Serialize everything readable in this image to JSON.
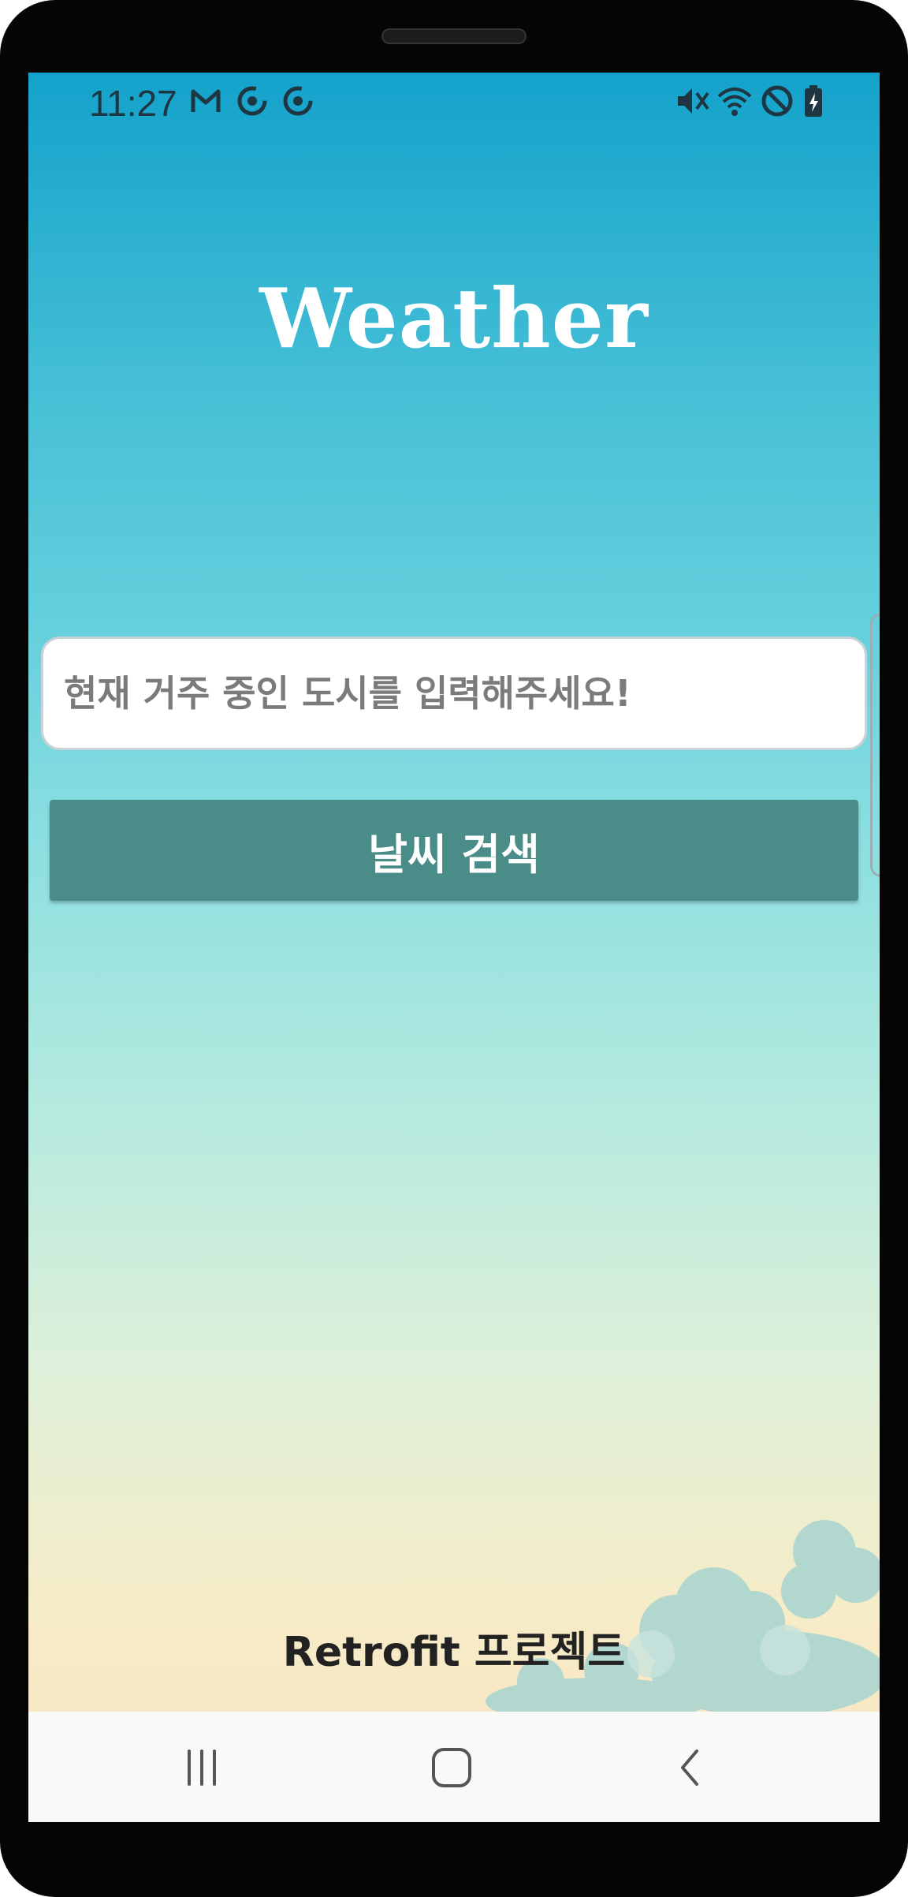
{
  "status_bar": {
    "time": "11:27",
    "left_icons": [
      "gmail-icon",
      "sync-icon",
      "sync-icon"
    ],
    "right_icons": [
      "mute-icon",
      "wifi-icon",
      "do-not-disturb-icon",
      "battery-charging-icon"
    ]
  },
  "app": {
    "title": "Weather",
    "search": {
      "placeholder": "현재 거주 중인 도시를 입력해주세요!",
      "value": ""
    },
    "search_button_label": "날씨 검색",
    "footer": "Retrofit 프로젝트"
  },
  "nav_bar": {
    "buttons": [
      "recent-apps-icon",
      "home-icon",
      "back-icon"
    ]
  },
  "colors": {
    "sky_top": "#14a2cb",
    "sky_bottom": "#fbe2c1",
    "button": "#4a8c88",
    "title": "#ffffff"
  }
}
